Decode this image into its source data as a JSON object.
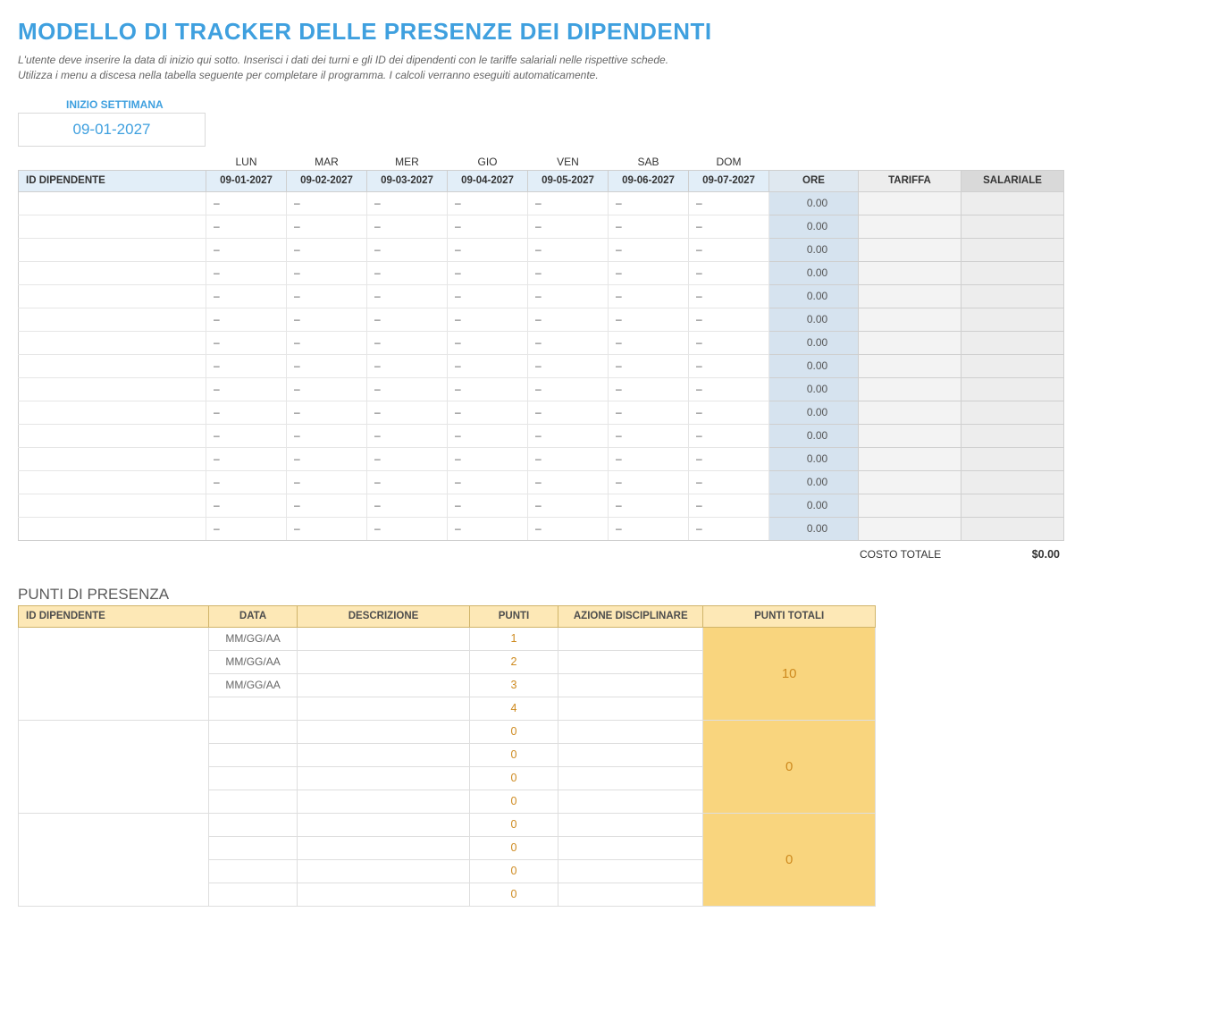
{
  "header": {
    "title": "MODELLO DI TRACKER DELLE PRESENZE DEI DIPENDENTI",
    "instr1": "L'utente deve inserire la data di inizio qui sotto.  Inserisci i dati dei turni e gli ID dei dipendenti con le tariffe salariali nelle rispettive schede.",
    "instr2": "Utilizza i menu a discesa nella tabella seguente per completare il programma. I calcoli verranno eseguiti automaticamente."
  },
  "week": {
    "label": "INIZIO SETTIMANA",
    "value": "09-01-2027"
  },
  "schedule": {
    "dow": [
      "LUN",
      "MAR",
      "MER",
      "GIO",
      "VEN",
      "SAB",
      "DOM"
    ],
    "id_header": "ID DIPENDENTE",
    "dates": [
      "09-01-2027",
      "09-02-2027",
      "09-03-2027",
      "09-04-2027",
      "09-05-2027",
      "09-06-2027",
      "09-07-2027"
    ],
    "ore_header": "ORE",
    "tar_header": "TARIFFA",
    "sal_header": "SALARIALE",
    "dash": "–",
    "rows": 15,
    "ore_value": "0.00",
    "total_label": "COSTO TOTALE",
    "total_value": "$0.00"
  },
  "presence": {
    "title": "PUNTI DI PRESENZA",
    "headers": {
      "id": "ID DIPENDENTE",
      "data": "DATA",
      "desc": "DESCRIZIONE",
      "punti": "PUNTI",
      "azione": "AZIONE DISCIPLINARE",
      "tot": "PUNTI TOTALI"
    },
    "groups": [
      {
        "rows": [
          {
            "data": "MM/GG/AA",
            "punti": "1"
          },
          {
            "data": "MM/GG/AA",
            "punti": "2"
          },
          {
            "data": "MM/GG/AA",
            "punti": "3"
          },
          {
            "data": "",
            "punti": "4"
          }
        ],
        "total": "10"
      },
      {
        "rows": [
          {
            "data": "",
            "punti": "0"
          },
          {
            "data": "",
            "punti": "0"
          },
          {
            "data": "",
            "punti": "0"
          },
          {
            "data": "",
            "punti": "0"
          }
        ],
        "total": "0"
      },
      {
        "rows": [
          {
            "data": "",
            "punti": "0"
          },
          {
            "data": "",
            "punti": "0"
          },
          {
            "data": "",
            "punti": "0"
          },
          {
            "data": "",
            "punti": "0"
          }
        ],
        "total": "0"
      }
    ]
  }
}
